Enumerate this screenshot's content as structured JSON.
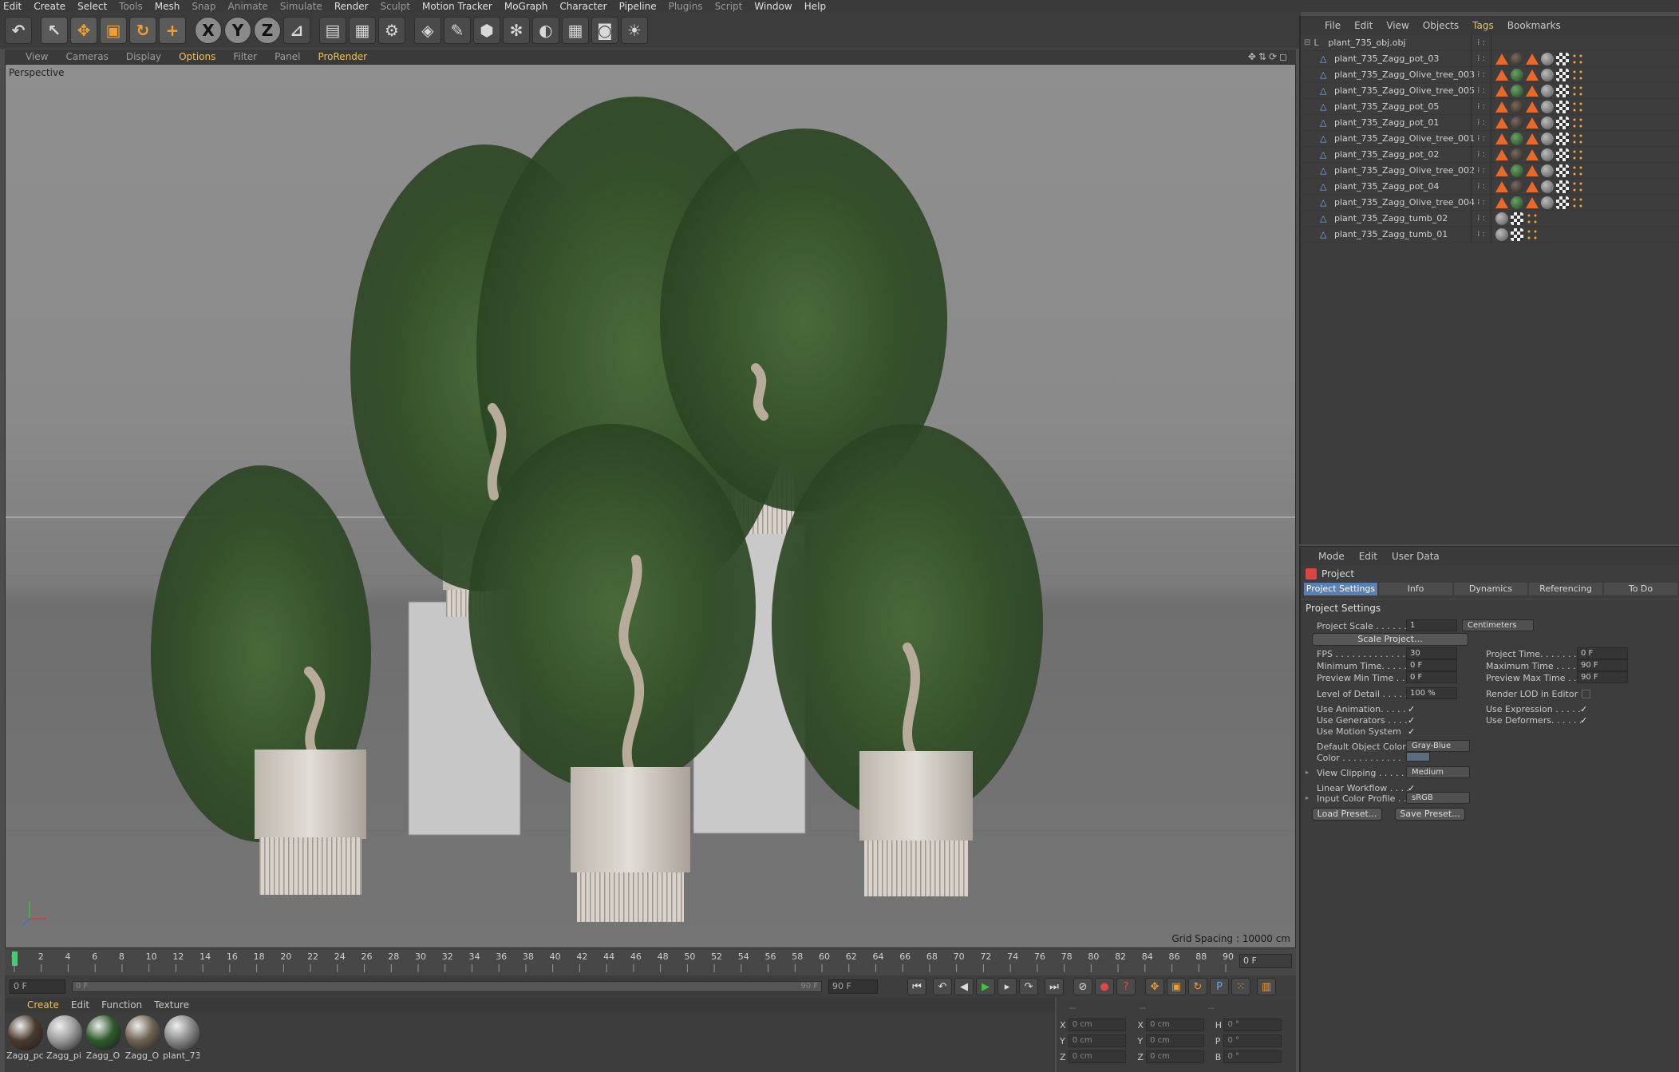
{
  "menubar": [
    "Edit",
    "Create",
    "Select",
    "Tools",
    "Mesh",
    "Snap",
    "Animate",
    "Simulate",
    "Render",
    "Sculpt",
    "Motion Tracker",
    "MoGraph",
    "Character",
    "Pipeline",
    "Plugins",
    "Script",
    "Window",
    "Help"
  ],
  "toolbar": {
    "icons": [
      "undo-icon",
      "select-tool-icon",
      "move-tool-icon",
      "scale-tool-icon",
      "rotate-tool-icon",
      "live-selection-icon",
      "x-axis-lock-icon",
      "y-axis-lock-icon",
      "z-axis-lock-icon",
      "coordinate-system-icon",
      "render-view-icon",
      "render-picture-viewer-icon",
      "edit-render-settings-icon",
      "cube-primitive-icon",
      "pen-spline-icon",
      "subdivision-icon",
      "array-icon",
      "deformer-icon",
      "floor-icon",
      "camera-icon",
      "light-icon"
    ],
    "axis_labels": [
      "X",
      "Y",
      "Z"
    ]
  },
  "viewport": {
    "menu": [
      "View",
      "Cameras",
      "Display",
      "Options",
      "Filter",
      "Panel",
      "ProRender"
    ],
    "active_menu": "Options",
    "camera_label": "Perspective",
    "grid_spacing": "Grid Spacing : 10000 cm"
  },
  "timeline": {
    "ticks": [
      "0",
      "2",
      "4",
      "6",
      "8",
      "10",
      "12",
      "14",
      "16",
      "18",
      "20",
      "22",
      "24",
      "26",
      "28",
      "30",
      "32",
      "34",
      "36",
      "38",
      "40",
      "42",
      "44",
      "46",
      "48",
      "50",
      "52",
      "54",
      "56",
      "58",
      "60",
      "62",
      "64",
      "66",
      "68",
      "70",
      "72",
      "74",
      "76",
      "78",
      "80",
      "82",
      "84",
      "86",
      "88",
      "90"
    ],
    "current_frame": "0 F",
    "start_field": "0 F",
    "range_start": "0 F",
    "range_end": "90 F",
    "end_field": "90 F"
  },
  "materials": {
    "menu": [
      "Create",
      "Edit",
      "Function",
      "Texture"
    ],
    "active_menu": "Create",
    "items": [
      {
        "name": "Zagg_pc",
        "color": "#4a3a2e"
      },
      {
        "name": "Zagg_pi",
        "color": "#9a9a9a"
      },
      {
        "name": "Zagg_O",
        "color": "#2e5a2a"
      },
      {
        "name": "Zagg_O",
        "color": "#6e6252"
      },
      {
        "name": "plant_73",
        "color": "#8a8a8a"
      }
    ]
  },
  "coordinates": {
    "header": [
      "--",
      "--",
      "--"
    ],
    "rows": [
      {
        "a": "X",
        "av": "0 cm",
        "b": "X",
        "bv": "0 cm",
        "c": "H",
        "cv": "0 °"
      },
      {
        "a": "Y",
        "av": "0 cm",
        "b": "Y",
        "bv": "0 cm",
        "c": "P",
        "cv": "0 °"
      },
      {
        "a": "Z",
        "av": "0 cm",
        "b": "Z",
        "bv": "0 cm",
        "c": "B",
        "cv": "0 °"
      }
    ]
  },
  "object_manager": {
    "menu": [
      "File",
      "Edit",
      "View",
      "Objects",
      "Tags",
      "Bookmarks"
    ],
    "active_menu": "Tags",
    "root": "plant_735_obj.obj",
    "objects": [
      {
        "name": "plant_735_Zagg_pot_03",
        "tags": [
          "tri",
          "dark",
          "tri",
          "ball",
          "check",
          "dots"
        ]
      },
      {
        "name": "plant_735_Zagg_Olive_tree_003",
        "tags": [
          "tri",
          "green",
          "tri",
          "ball",
          "check",
          "dots"
        ]
      },
      {
        "name": "plant_735_Zagg_Olive_tree_005",
        "tags": [
          "tri",
          "green",
          "tri",
          "ball",
          "check",
          "dots"
        ]
      },
      {
        "name": "plant_735_Zagg_pot_05",
        "tags": [
          "tri",
          "dark",
          "tri",
          "ball",
          "check",
          "dots"
        ]
      },
      {
        "name": "plant_735_Zagg_pot_01",
        "tags": [
          "tri",
          "dark",
          "tri",
          "ball",
          "check",
          "dots"
        ]
      },
      {
        "name": "plant_735_Zagg_Olive_tree_001",
        "tags": [
          "tri",
          "green",
          "tri",
          "ball",
          "check",
          "dots"
        ]
      },
      {
        "name": "plant_735_Zagg_pot_02",
        "tags": [
          "tri",
          "dark",
          "tri",
          "ball",
          "check",
          "dots"
        ]
      },
      {
        "name": "plant_735_Zagg_Olive_tree_002",
        "tags": [
          "tri",
          "green",
          "tri",
          "ball",
          "check",
          "dots"
        ]
      },
      {
        "name": "plant_735_Zagg_pot_04",
        "tags": [
          "tri",
          "dark",
          "tri",
          "ball",
          "check",
          "dots"
        ]
      },
      {
        "name": "plant_735_Zagg_Olive_tree_004",
        "tags": [
          "tri",
          "green",
          "tri",
          "ball",
          "check",
          "dots"
        ]
      },
      {
        "name": "plant_735_Zagg_tumb_02",
        "tags": [
          "ball",
          "check",
          "dots"
        ]
      },
      {
        "name": "plant_735_Zagg_tumb_01",
        "tags": [
          "ball",
          "check",
          "dots"
        ]
      }
    ]
  },
  "attributes": {
    "menu": [
      "Mode",
      "Edit",
      "User Data"
    ],
    "title": "Project",
    "tabs": [
      "Project Settings",
      "Info",
      "Dynamics",
      "Referencing",
      "To Do"
    ],
    "active_tab": "Project Settings",
    "section": "Project Settings",
    "project_scale_label": "Project Scale . . . . . .",
    "project_scale_value": "1",
    "project_scale_unit": "Centimeters",
    "scale_project_button": "Scale Project...",
    "fps_label": "FPS . . . . . . . . . . . . . .",
    "fps_value": "30",
    "project_time_label": "Project Time. . . . . . .",
    "project_time_value": "0 F",
    "min_time_label": "Minimum Time. . . . .",
    "min_time_value": "0 F",
    "max_time_label": "Maximum Time . . . .",
    "max_time_value": "90 F",
    "prev_min_label": "Preview Min Time . . .",
    "prev_min_value": "0 F",
    "prev_max_label": "Preview Max Time . .",
    "prev_max_value": "90 F",
    "lod_label": "Level of Detail . . . . .",
    "lod_value": "100 %",
    "render_lod_label": "Render LOD in Editor",
    "use_animation_label": "Use Animation. . . . .",
    "use_expression_label": "Use Expression . . . . .",
    "use_generators_label": "Use Generators . . . .",
    "use_deformers_label": "Use Deformers. . . . . .",
    "use_motion_label": "Use Motion System",
    "default_color_label": "Default Object Color",
    "default_color_value": "Gray-Blue",
    "color_label": "Color . . . . . . . . . . .",
    "view_clipping_label": "View Clipping . . . . . .",
    "view_clipping_value": "Medium",
    "linear_workflow_label": "Linear Workflow . . . .",
    "input_color_label": "Input Color Profile . . .",
    "input_color_value": "sRGB",
    "load_preset": "Load Preset...",
    "save_preset": "Save Preset..."
  }
}
